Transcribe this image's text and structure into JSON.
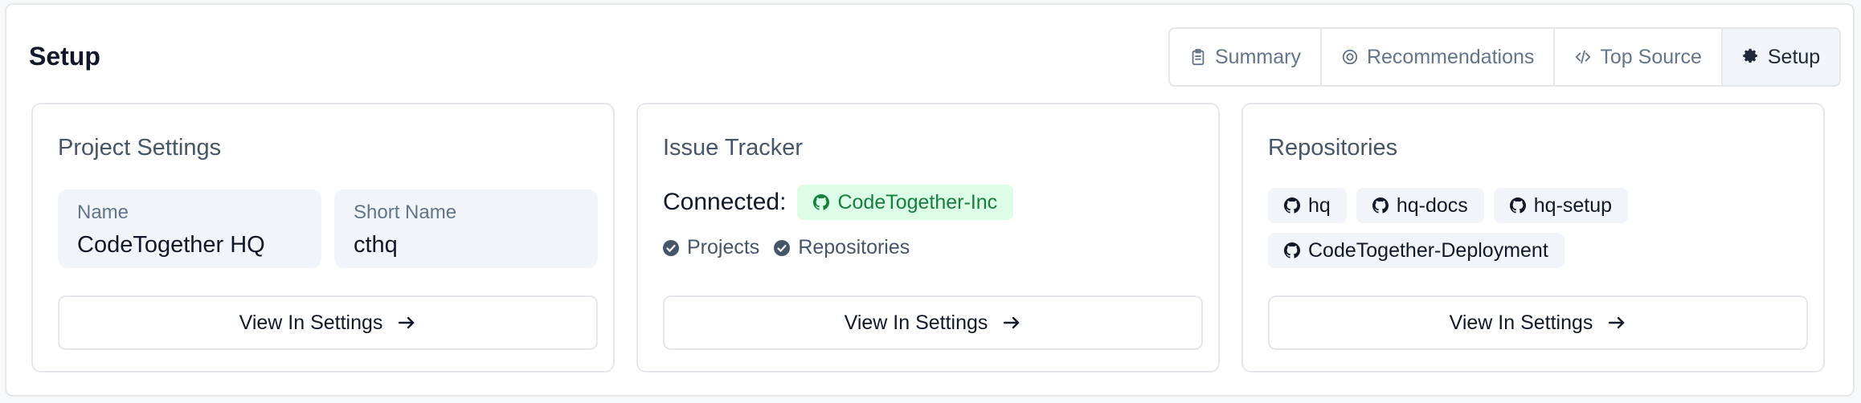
{
  "page": {
    "title": "Setup"
  },
  "tabs": [
    {
      "label": "Summary",
      "icon": "clipboard-icon",
      "active": false
    },
    {
      "label": "Recommendations",
      "icon": "target-icon",
      "active": false
    },
    {
      "label": "Top Source",
      "icon": "code-icon",
      "active": false
    },
    {
      "label": "Setup",
      "icon": "gear-icon",
      "active": true
    }
  ],
  "project_settings": {
    "title": "Project Settings",
    "name_label": "Name",
    "name_value": "CodeTogether HQ",
    "short_name_label": "Short Name",
    "short_name_value": "cthq",
    "button_label": "View In Settings"
  },
  "issue_tracker": {
    "title": "Issue Tracker",
    "connected_label": "Connected:",
    "connected_org": "CodeTogether-Inc",
    "permissions": [
      "Projects",
      "Repositories"
    ],
    "button_label": "View In Settings"
  },
  "repositories": {
    "title": "Repositories",
    "items": [
      "hq",
      "hq-docs",
      "hq-setup",
      "CodeTogether-Deployment"
    ],
    "button_label": "View In Settings"
  },
  "colors": {
    "accent_green_bg": "#dcfce7",
    "accent_green_text": "#15803d",
    "chip_bg": "#f1f5f9"
  }
}
